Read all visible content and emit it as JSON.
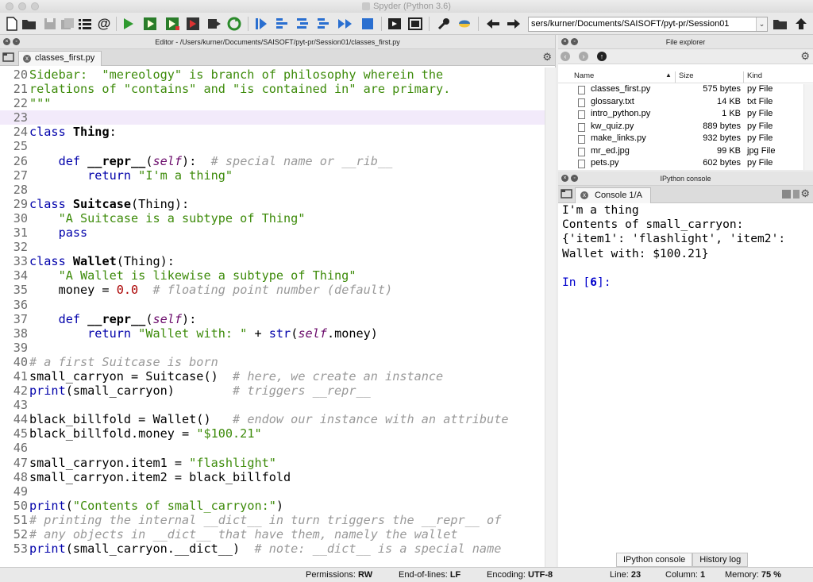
{
  "window": {
    "title": "Spyder (Python 3.6)"
  },
  "toolbar": {
    "path_value": "sers/kurner/Documents/SAISOFT/pyt-pr/Session01",
    "dropdown_glyph": "⌄",
    "icons": [
      "new-file-icon",
      "open-folder-icon",
      "save-icon",
      "save-all-icon",
      "list-icon",
      "at-icon",
      "run-icon",
      "run-cell-icon",
      "run-cell-advance-icon",
      "run-selection-icon",
      "rerun-icon",
      "debug-step-icon",
      "step-into-icon",
      "step-return-icon",
      "continue-icon",
      "stop-debug-icon",
      "maximize-icon",
      "fullscreen-icon",
      "preferences-icon",
      "python-path-icon",
      "back-arrow-icon",
      "forward-arrow-icon",
      "browse-folder-icon",
      "up-arrow-icon"
    ]
  },
  "editor": {
    "header": "Editor - /Users/kurner/Documents/SAISOFT/pyt-pr/Session01/classes_first.py",
    "tab_label": "classes_first.py",
    "close_glyph": "x",
    "current_line": 23,
    "lines": [
      {
        "n": "20",
        "parts": [
          [
            "st",
            "Sidebar:  \"mereology\" is branch of philosophy wherein the"
          ]
        ]
      },
      {
        "n": "21",
        "parts": [
          [
            "st",
            "relations of \"contains\" and \"is contained in\" are primary."
          ]
        ]
      },
      {
        "n": "22",
        "parts": [
          [
            "st",
            "\"\"\""
          ]
        ]
      },
      {
        "n": "23",
        "parts": []
      },
      {
        "n": "24",
        "parts": [
          [
            "kw",
            "class "
          ],
          [
            "bold",
            "Thing"
          ],
          [
            "lc",
            ":"
          ]
        ]
      },
      {
        "n": "25",
        "parts": []
      },
      {
        "n": "26",
        "parts": [
          [
            "lc",
            "    "
          ],
          [
            "kw",
            "def "
          ],
          [
            "bold",
            "__repr__"
          ],
          [
            "lc",
            "("
          ],
          [
            "sf",
            "self"
          ],
          [
            "lc",
            "):  "
          ],
          [
            "cm",
            "# special name or __rib__"
          ]
        ]
      },
      {
        "n": "27",
        "parts": [
          [
            "lc",
            "        "
          ],
          [
            "kw",
            "return "
          ],
          [
            "st",
            "\"I'm a thing\""
          ]
        ]
      },
      {
        "n": "28",
        "parts": []
      },
      {
        "n": "29",
        "parts": [
          [
            "kw",
            "class "
          ],
          [
            "bold",
            "Suitcase"
          ],
          [
            "lc",
            "(Thing):"
          ]
        ]
      },
      {
        "n": "30",
        "parts": [
          [
            "lc",
            "    "
          ],
          [
            "st",
            "\"A Suitcase is a subtype of Thing\""
          ]
        ]
      },
      {
        "n": "31",
        "parts": [
          [
            "lc",
            "    "
          ],
          [
            "kw",
            "pass"
          ]
        ]
      },
      {
        "n": "32",
        "parts": []
      },
      {
        "n": "33",
        "parts": [
          [
            "kw",
            "class "
          ],
          [
            "bold",
            "Wallet"
          ],
          [
            "lc",
            "(Thing):"
          ]
        ]
      },
      {
        "n": "34",
        "parts": [
          [
            "lc",
            "    "
          ],
          [
            "st",
            "\"A Wallet is likewise a subtype of Thing\""
          ]
        ]
      },
      {
        "n": "35",
        "parts": [
          [
            "lc",
            "    money = "
          ],
          [
            "nm",
            "0.0"
          ],
          [
            "lc",
            "  "
          ],
          [
            "cm",
            "# floating point number (default)"
          ]
        ]
      },
      {
        "n": "36",
        "parts": []
      },
      {
        "n": "37",
        "parts": [
          [
            "lc",
            "    "
          ],
          [
            "kw",
            "def "
          ],
          [
            "bold",
            "__repr__"
          ],
          [
            "lc",
            "("
          ],
          [
            "sf",
            "self"
          ],
          [
            "lc",
            "):"
          ]
        ]
      },
      {
        "n": "38",
        "parts": [
          [
            "lc",
            "        "
          ],
          [
            "kw",
            "return "
          ],
          [
            "st",
            "\"Wallet with: \""
          ],
          [
            "lc",
            " + "
          ],
          [
            "kw",
            "str"
          ],
          [
            "lc",
            "("
          ],
          [
            "sf",
            "self"
          ],
          [
            "lc",
            ".money)"
          ]
        ]
      },
      {
        "n": "39",
        "parts": []
      },
      {
        "n": "40",
        "parts": [
          [
            "cm",
            "# a first Suitcase is born"
          ]
        ]
      },
      {
        "n": "41",
        "parts": [
          [
            "lc",
            "small_carryon = Suitcase()  "
          ],
          [
            "cm",
            "# here, we create an instance"
          ]
        ]
      },
      {
        "n": "42",
        "parts": [
          [
            "kw",
            "print"
          ],
          [
            "lc",
            "(small_carryon)        "
          ],
          [
            "cm",
            "# triggers __repr__"
          ]
        ]
      },
      {
        "n": "43",
        "parts": []
      },
      {
        "n": "44",
        "parts": [
          [
            "lc",
            "black_billfold = Wallet()   "
          ],
          [
            "cm",
            "# endow our instance with an attribute"
          ]
        ]
      },
      {
        "n": "45",
        "parts": [
          [
            "lc",
            "black_billfold.money = "
          ],
          [
            "st",
            "\"$100.21\""
          ]
        ]
      },
      {
        "n": "46",
        "parts": []
      },
      {
        "n": "47",
        "parts": [
          [
            "lc",
            "small_carryon.item1 = "
          ],
          [
            "st",
            "\"flashlight\""
          ]
        ]
      },
      {
        "n": "48",
        "parts": [
          [
            "lc",
            "small_carryon.item2 = black_billfold"
          ]
        ]
      },
      {
        "n": "49",
        "parts": []
      },
      {
        "n": "50",
        "parts": [
          [
            "kw",
            "print"
          ],
          [
            "lc",
            "("
          ],
          [
            "st",
            "\"Contents of small_carryon:\""
          ],
          [
            "lc",
            ")"
          ]
        ]
      },
      {
        "n": "51",
        "parts": [
          [
            "cm",
            "# printing the internal __dict__ in turn triggers the __repr__ of"
          ]
        ]
      },
      {
        "n": "52",
        "parts": [
          [
            "cm",
            "# any objects in __dict__ that have them, namely the wallet"
          ]
        ]
      },
      {
        "n": "53",
        "parts": [
          [
            "kw",
            "print"
          ],
          [
            "lc",
            "(small_carryon.__dict__)  "
          ],
          [
            "cm",
            "# note: __dict__ is a special name"
          ]
        ]
      }
    ]
  },
  "file_explorer": {
    "header": "File explorer",
    "columns": {
      "name": "Name",
      "size": "Size",
      "kind": "Kind"
    },
    "sort_glyph": "▲",
    "files": [
      {
        "name": "classes_first.py",
        "size": "575 bytes",
        "kind": "py File"
      },
      {
        "name": "glossary.txt",
        "size": "14 KB",
        "kind": "txt File"
      },
      {
        "name": "intro_python.py",
        "size": "1 KB",
        "kind": "py File"
      },
      {
        "name": "kw_quiz.py",
        "size": "889 bytes",
        "kind": "py File"
      },
      {
        "name": "make_links.py",
        "size": "932 bytes",
        "kind": "py File"
      },
      {
        "name": "mr_ed.jpg",
        "size": "99 KB",
        "kind": "jpg File"
      },
      {
        "name": "pets.py",
        "size": "602 bytes",
        "kind": "py File"
      }
    ]
  },
  "ipython": {
    "header": "IPython console",
    "tab_label": "Console 1/A",
    "output": [
      "I'm a thing",
      "Contents of small_carryon:",
      "{'item1': 'flashlight', 'item2':",
      "Wallet with: $100.21}",
      ""
    ],
    "prompt_label": "In [",
    "prompt_number": "6",
    "prompt_end": "]:",
    "bottom_tabs": [
      "IPython console",
      "History log"
    ]
  },
  "status": {
    "permissions_label": "Permissions:",
    "permissions": "RW",
    "eol_label": "End-of-lines:",
    "eol": "LF",
    "encoding_label": "Encoding:",
    "encoding": "UTF-8",
    "line_label": "Line:",
    "line": "23",
    "column_label": "Column:",
    "column": "1",
    "memory_label": "Memory:",
    "memory": "75 %"
  },
  "colors": {
    "keyword": "#0000aa",
    "string": "#3d8b0a",
    "comment": "#999999",
    "current_line": "#f2eafa"
  }
}
